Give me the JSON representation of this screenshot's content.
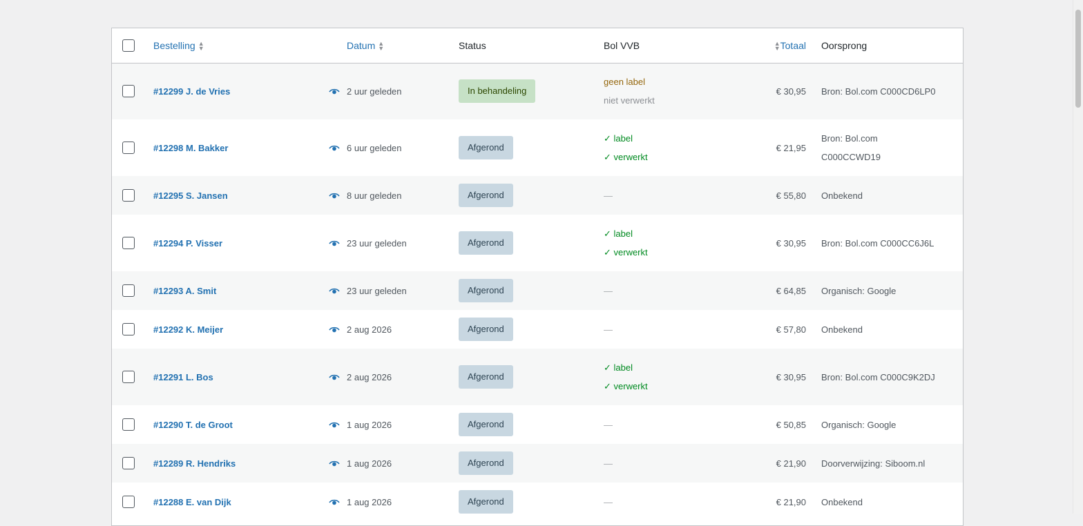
{
  "columns": {
    "order": "Bestelling",
    "date": "Datum",
    "status": "Status",
    "bol": "Bol VVB",
    "total": "Totaal",
    "origin": "Oorsprong"
  },
  "rows": [
    {
      "order": "#12299 J. de Vries",
      "date": "2 uur geleden",
      "status": "In behandeling",
      "status_type": "processing",
      "bol": [
        "geen label",
        "niet verwerkt"
      ],
      "bol_type": "pending",
      "total": "€ 30,95",
      "origin": "Bron: Bol.com C000CD6LP0"
    },
    {
      "order": "#12298 M. Bakker",
      "date": "6 uur geleden",
      "status": "Afgerond",
      "status_type": "completed",
      "bol": [
        "✓ label",
        "✓ verwerkt"
      ],
      "bol_type": "done",
      "total": "€ 21,95",
      "origin": "Bron: Bol.com C000CCWD19"
    },
    {
      "order": "#12295 S. Jansen",
      "date": "8 uur geleden",
      "status": "Afgerond",
      "status_type": "completed",
      "bol": [
        "—"
      ],
      "bol_type": "none",
      "total": "€ 55,80",
      "origin": "Onbekend"
    },
    {
      "order": "#12294 P. Visser",
      "date": "23 uur geleden",
      "status": "Afgerond",
      "status_type": "completed",
      "bol": [
        "✓ label",
        "✓ verwerkt"
      ],
      "bol_type": "done",
      "total": "€ 30,95",
      "origin": "Bron: Bol.com C000CC6J6L"
    },
    {
      "order": "#12293 A. Smit",
      "date": "23 uur geleden",
      "status": "Afgerond",
      "status_type": "completed",
      "bol": [
        "—"
      ],
      "bol_type": "none",
      "total": "€ 64,85",
      "origin": "Organisch: Google"
    },
    {
      "order": "#12292 K. Meijer",
      "date": "2 aug 2026",
      "status": "Afgerond",
      "status_type": "completed",
      "bol": [
        "—"
      ],
      "bol_type": "none",
      "total": "€ 57,80",
      "origin": "Onbekend"
    },
    {
      "order": "#12291 L. Bos",
      "date": "2 aug 2026",
      "status": "Afgerond",
      "status_type": "completed",
      "bol": [
        "✓ label",
        "✓ verwerkt"
      ],
      "bol_type": "done",
      "total": "€ 30,95",
      "origin": "Bron: Bol.com C000C9K2DJ"
    },
    {
      "order": "#12290 T. de Groot",
      "date": "1 aug 2026",
      "status": "Afgerond",
      "status_type": "completed",
      "bol": [
        "—"
      ],
      "bol_type": "none",
      "total": "€ 50,85",
      "origin": "Organisch: Google"
    },
    {
      "order": "#12289 R. Hendriks",
      "date": "1 aug 2026",
      "status": "Afgerond",
      "status_type": "completed",
      "bol": [
        "—"
      ],
      "bol_type": "none",
      "total": "€ 21,90",
      "origin": "Doorverwijzing: Siboom.nl"
    },
    {
      "order": "#12288 E. van Dijk",
      "date": "1 aug 2026",
      "status": "Afgerond",
      "status_type": "completed",
      "bol": [
        "—"
      ],
      "bol_type": "none",
      "total": "€ 21,90",
      "origin": "Onbekend"
    }
  ],
  "colors": {
    "link": "#2271b1",
    "processing_bg": "#c6e1c6",
    "completed_bg": "#c8d7e1",
    "ok": "#008a20",
    "warn": "#94660c"
  }
}
